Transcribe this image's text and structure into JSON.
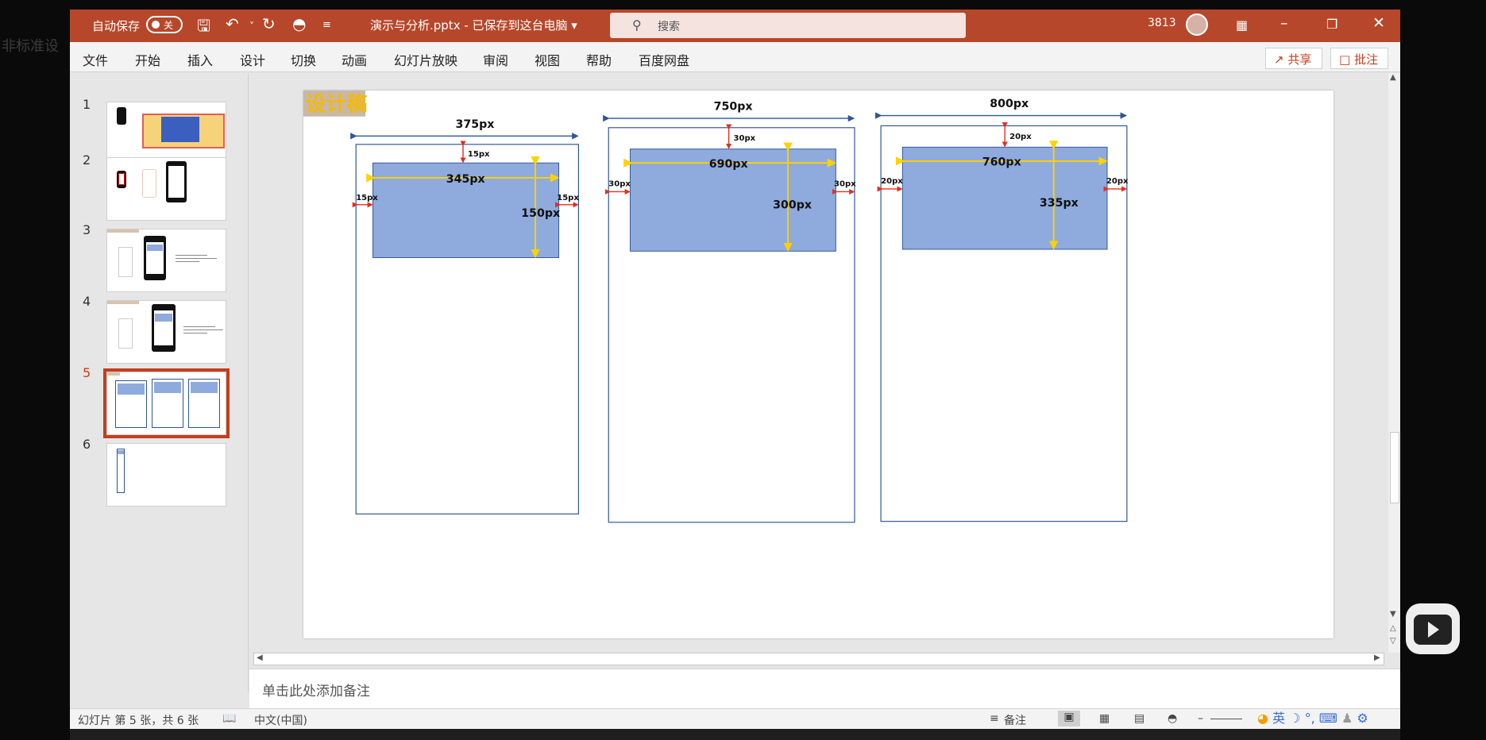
{
  "background": {
    "left_overlay_text": "非标准设"
  },
  "titlebar": {
    "autosave_label": "自动保存",
    "autosave_state": "关",
    "doc_title": "演示与分析.pptx - 已保存到这台电脑 ▾",
    "search_placeholder": "搜索",
    "user_id": "3813",
    "color": "#b7472a"
  },
  "menu": {
    "items": [
      "文件",
      "开始",
      "插入",
      "设计",
      "切换",
      "动画",
      "幻灯片放映",
      "审阅",
      "视图",
      "帮助",
      "百度网盘"
    ],
    "share_label": "共享",
    "comment_label": "批注"
  },
  "thumbnails": {
    "numbers": [
      "1",
      "2",
      "3",
      "4",
      "5",
      "6"
    ],
    "active_index": 5
  },
  "slide": {
    "tag": "设计稿",
    "frames": [
      {
        "width_label": "375px",
        "top_label": "15px",
        "left_label": "15px",
        "right_label": "15px",
        "inner_width_label": "345px",
        "inner_height_label": "150px"
      },
      {
        "width_label": "750px",
        "top_label": "30px",
        "left_label": "30px",
        "right_label": "30px",
        "inner_width_label": "690px",
        "inner_height_label": "300px"
      },
      {
        "width_label": "800px",
        "top_label": "20px",
        "left_label": "20px",
        "right_label": "20px",
        "inner_width_label": "760px",
        "inner_height_label": "335px"
      }
    ],
    "box_color": "#8faadc",
    "measure_color": "#ffd200",
    "margin_color": "#e03020",
    "width_arrow_color": "#2f5597"
  },
  "notes": {
    "placeholder": "单击此处添加备注"
  },
  "status": {
    "slide_info": "幻灯片 第 5 张，共 6 张",
    "language": "中文(中国)",
    "notes_label": "备注"
  },
  "ime": {
    "label": "英"
  }
}
